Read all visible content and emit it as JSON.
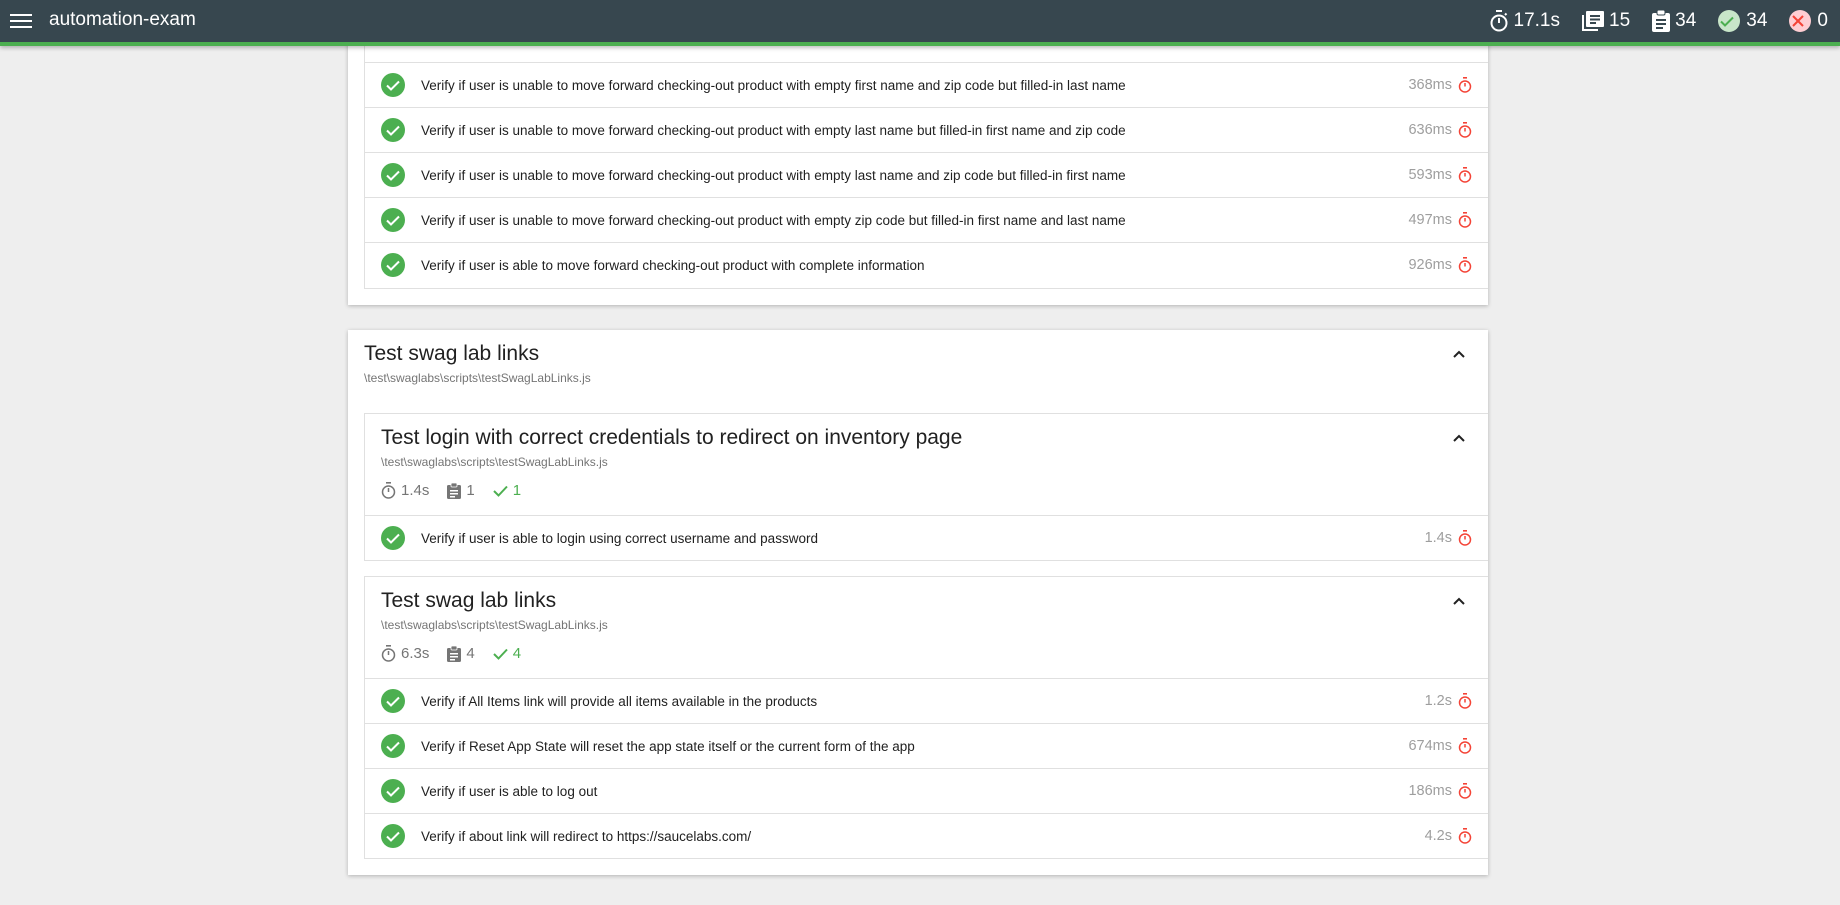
{
  "app": {
    "title": "automation-exam"
  },
  "stats": {
    "duration": "17.1s",
    "suites": "15",
    "tests": "34",
    "passes": "34",
    "failures": "0"
  },
  "colors": {
    "topbar": "#37474f",
    "pass": "#4caf50",
    "fail": "#f44336",
    "accent_border": "#4caf50"
  },
  "first_card": {
    "tests": [
      {
        "title": "Verify if user is unable to move forward checking-out product with empty first name and zip code but filled-in last name",
        "duration": "368ms"
      },
      {
        "title": "Verify if user is unable to move forward checking-out product with empty last name but filled-in first name and zip code",
        "duration": "636ms"
      },
      {
        "title": "Verify if user is unable to move forward checking-out product with empty last name and zip code but filled-in first name",
        "duration": "593ms"
      },
      {
        "title": "Verify if user is unable to move forward checking-out product with empty zip code but filled-in first name and last name",
        "duration": "497ms"
      },
      {
        "title": "Verify if user is able to move forward checking-out product with complete information",
        "duration": "926ms"
      }
    ]
  },
  "second_card": {
    "title": "Test swag lab links",
    "path": "\\test\\swaglabs\\scripts\\testSwagLabLinks.js",
    "suites": [
      {
        "title": "Test login with correct credentials to redirect on inventory page",
        "path": "\\test\\swaglabs\\scripts\\testSwagLabLinks.js",
        "duration": "1.4s",
        "tests_count": "1",
        "passes_count": "1",
        "tests": [
          {
            "title": "Verify if user is able to login using correct username and password",
            "duration": "1.4s"
          }
        ]
      },
      {
        "title": "Test swag lab links",
        "path": "\\test\\swaglabs\\scripts\\testSwagLabLinks.js",
        "duration": "6.3s",
        "tests_count": "4",
        "passes_count": "4",
        "tests": [
          {
            "title": "Verify if All Items link will provide all items available in the products",
            "duration": "1.2s"
          },
          {
            "title": "Verify if Reset App State will reset the app state itself or the current form of the app",
            "duration": "674ms"
          },
          {
            "title": "Verify if user is able to log out",
            "duration": "186ms"
          },
          {
            "title": "Verify if about link will redirect to https://saucelabs.com/",
            "duration": "4.2s"
          }
        ]
      }
    ]
  }
}
